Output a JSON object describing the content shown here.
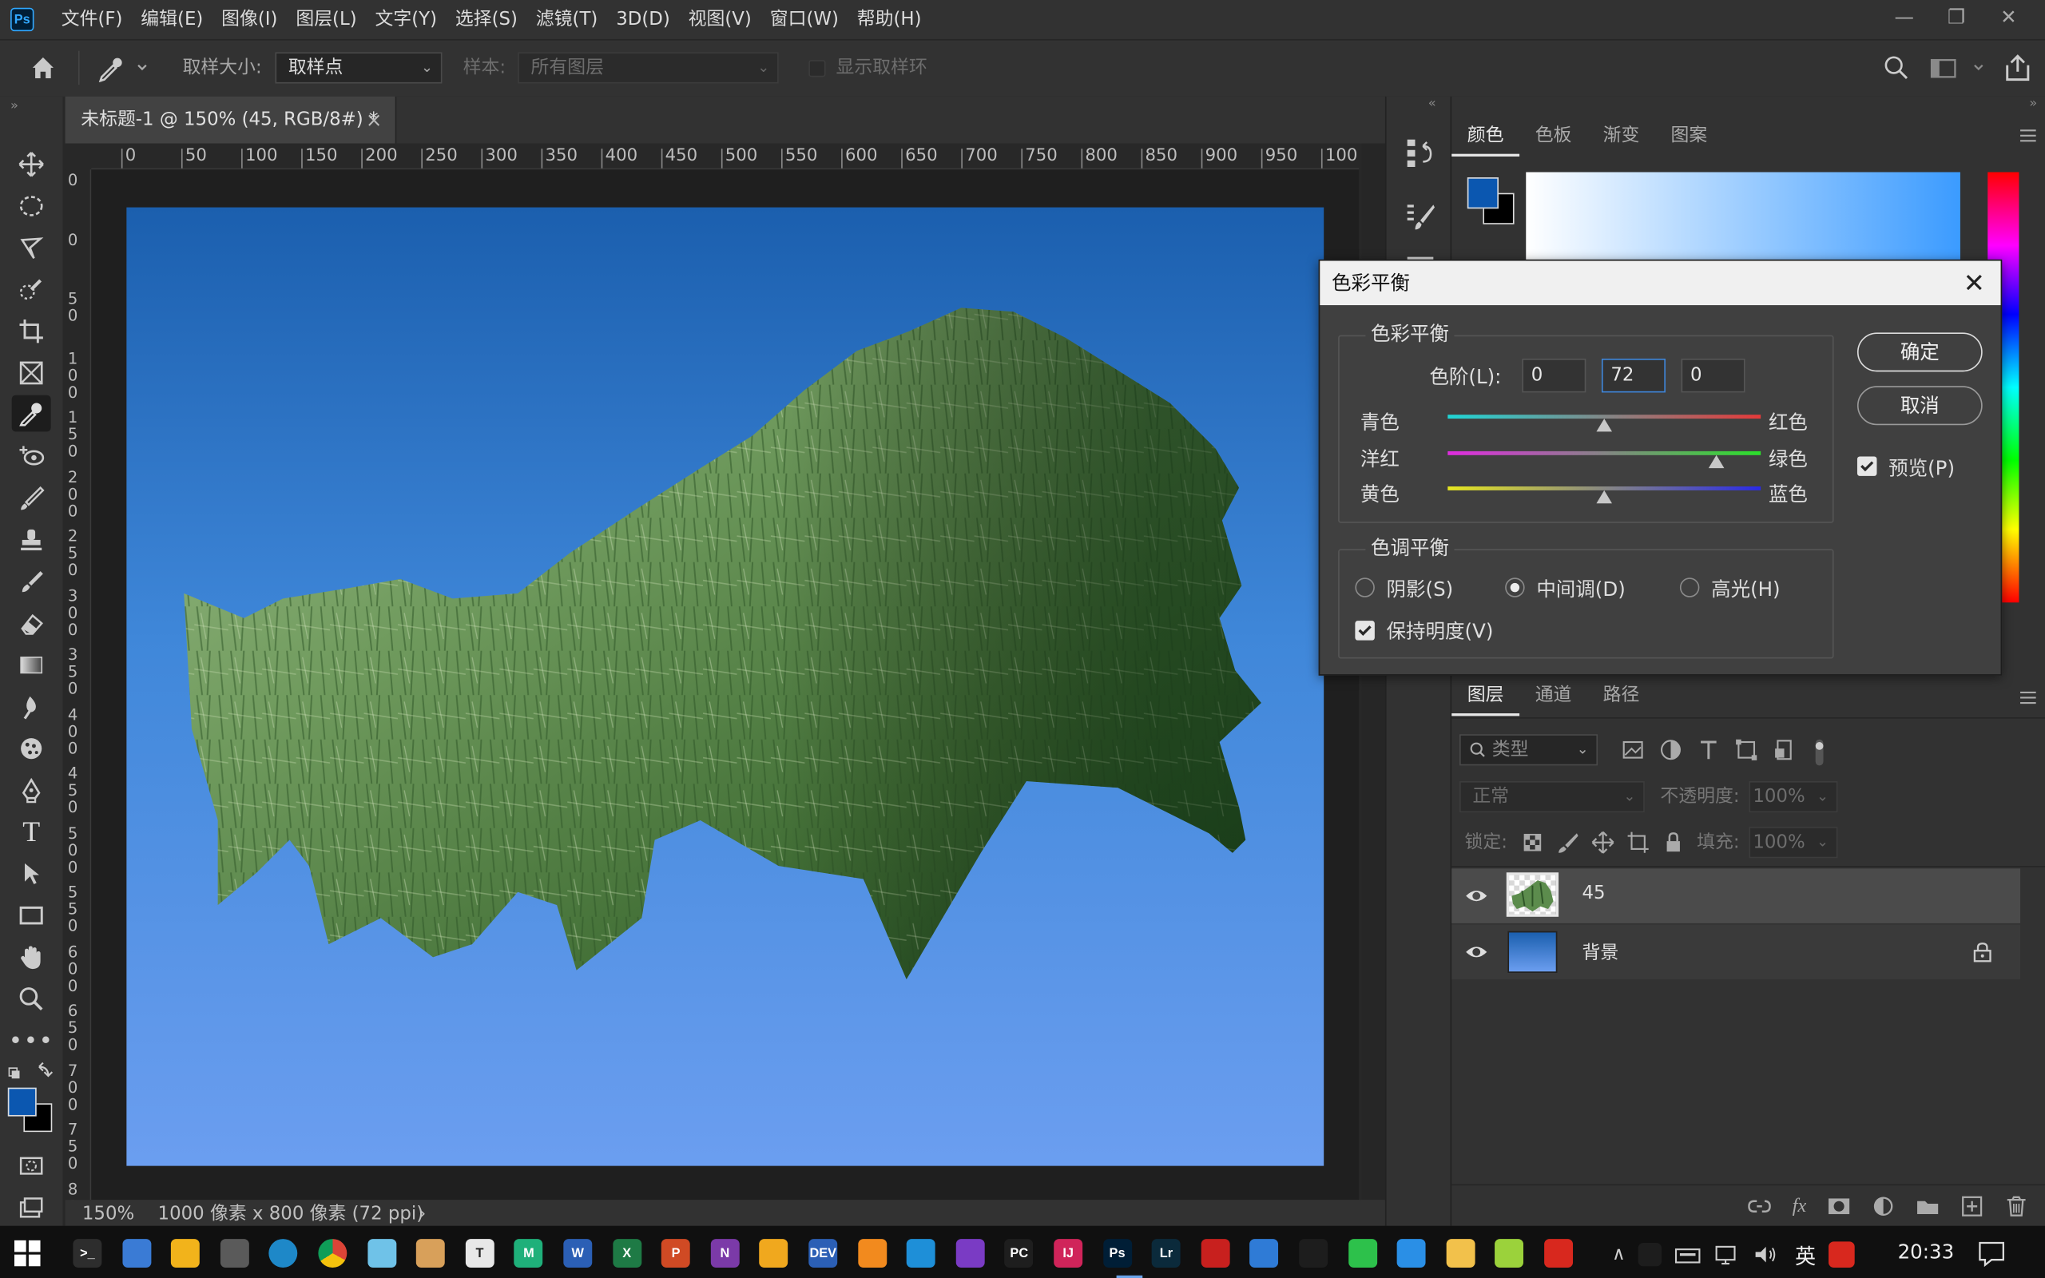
{
  "menubar": {
    "logo": "Ps",
    "items": [
      "文件(F)",
      "编辑(E)",
      "图像(I)",
      "图层(L)",
      "文字(Y)",
      "选择(S)",
      "滤镜(T)",
      "3D(D)",
      "视图(V)",
      "窗口(W)",
      "帮助(H)"
    ],
    "window_controls": [
      "—",
      "❐",
      "✕"
    ]
  },
  "options": {
    "sample_size_label": "取样大小:",
    "sample_size_value": "取样点",
    "sample_label": "样本:",
    "sample_value": "所有图层",
    "show_ring_label": "显示取样环"
  },
  "document": {
    "tab_title": "未标题-1 @ 150% (45, RGB/8#) *",
    "close": "×",
    "ruler_h": [
      "0",
      "50",
      "100",
      "150",
      "200",
      "250",
      "300",
      "350",
      "400",
      "450",
      "500",
      "550",
      "600",
      "650",
      "700",
      "750",
      "800",
      "850",
      "900",
      "950",
      "100"
    ],
    "ruler_v": [
      "0",
      "0",
      "5\n0",
      "1\n0\n0",
      "1\n5\n0",
      "2\n0\n0",
      "2\n5\n0",
      "3\n0\n0",
      "3\n5\n0",
      "4\n0\n0",
      "4\n5\n0",
      "5\n0\n0",
      "5\n5\n0",
      "6\n0\n0",
      "6\n5\n0",
      "7\n0\n0",
      "7\n5\n0",
      "8\n0\n0"
    ],
    "gradient_colors": [
      "#1b5fae",
      "#6b9ef0"
    ]
  },
  "status": {
    "zoom": "150%",
    "info": "1000 像素 x 800 像素 (72 ppi)",
    "arrow": "›"
  },
  "color_panel": {
    "tabs": [
      "颜色",
      "色板",
      "渐变",
      "图案"
    ],
    "foreground": "#0b57b0",
    "background": "#000000"
  },
  "layers_panel": {
    "tabs": [
      "图层",
      "通道",
      "路径"
    ],
    "filter_label": "类型",
    "blend_mode": "正常",
    "opacity_label": "不透明度:",
    "opacity_value": "100%",
    "lock_label": "锁定:",
    "fill_label": "填充:",
    "fill_value": "100%",
    "layers": [
      {
        "name": "45",
        "selected": true
      },
      {
        "name": "背景",
        "selected": false,
        "locked": true
      }
    ]
  },
  "dialog": {
    "title": "色彩平衡",
    "close": "✕",
    "balance_group": "色彩平衡",
    "levels_label": "色阶(L):",
    "levels": [
      "0",
      "72",
      "0"
    ],
    "sliders": [
      {
        "left": "青色",
        "right": "红色",
        "value": 0,
        "colors": [
          "#1fd6d6",
          "#e53a3a"
        ]
      },
      {
        "left": "洋红",
        "right": "绿色",
        "value": 72,
        "colors": [
          "#e02be0",
          "#2be02b"
        ]
      },
      {
        "left": "黄色",
        "right": "蓝色",
        "value": 0,
        "colors": [
          "#e6e620",
          "#2a2ae6"
        ]
      }
    ],
    "tone_group": "色调平衡",
    "tones": [
      "阴影(S)",
      "中间调(D)",
      "高光(H)"
    ],
    "tone_selected": 1,
    "preserve_label": "保持明度(V)",
    "ok": "确定",
    "cancel": "取消",
    "preview_label": "预览(P)"
  },
  "taskbar": {
    "time": "20:33",
    "ime": "英",
    "apps": [
      {
        "name": "terminal",
        "label": ">_",
        "color": "#2d2d2d"
      },
      {
        "name": "pc",
        "label": "",
        "color": "#3a7bd5"
      },
      {
        "name": "explorer",
        "label": "",
        "color": "#f2b31b"
      },
      {
        "name": "calculator",
        "label": "",
        "color": "#5a5a5a"
      },
      {
        "name": "edge",
        "label": "",
        "color": "#1e88c8"
      },
      {
        "name": "chrome",
        "label": "",
        "color": "#e0e0e0"
      },
      {
        "name": "notes",
        "label": "",
        "color": "#6fc2e8"
      },
      {
        "name": "paint",
        "label": "",
        "color": "#d8a05a"
      },
      {
        "name": "typora",
        "label": "T",
        "color": "#e8e8e8"
      },
      {
        "name": "mindmaster",
        "label": "M",
        "color": "#1fb07a"
      },
      {
        "name": "word",
        "label": "W",
        "color": "#2b5fb5"
      },
      {
        "name": "excel",
        "label": "X",
        "color": "#1e7a45"
      },
      {
        "name": "powerpoint",
        "label": "P",
        "color": "#d04a24"
      },
      {
        "name": "onenote",
        "label": "N",
        "color": "#7b3aa8"
      },
      {
        "name": "evernote",
        "label": "",
        "color": "#f0a81e"
      },
      {
        "name": "devcpp",
        "label": "DEV",
        "color": "#2b5fb5"
      },
      {
        "name": "sublime",
        "label": "",
        "color": "#f28a1e"
      },
      {
        "name": "vscode",
        "label": "",
        "color": "#1e8fd8"
      },
      {
        "name": "visualstudio",
        "label": "",
        "color": "#7a3bc4"
      },
      {
        "name": "pycharm",
        "label": "PC",
        "color": "#1e1e1e"
      },
      {
        "name": "intellij",
        "label": "IJ",
        "color": "#d0245a"
      },
      {
        "name": "photoshop",
        "label": "Ps",
        "color": "#001e36"
      },
      {
        "name": "lightroom",
        "label": "Lr",
        "color": "#0b2a3b"
      },
      {
        "name": "acrobat",
        "label": "",
        "color": "#c8201e"
      },
      {
        "name": "app-blue",
        "label": "",
        "color": "#2f7bd6"
      },
      {
        "name": "qq",
        "label": "",
        "color": "#1d1d1d"
      },
      {
        "name": "wechat",
        "label": "",
        "color": "#2dc14b"
      },
      {
        "name": "app-feather",
        "label": "",
        "color": "#2a8fe6"
      },
      {
        "name": "app-shop",
        "label": "",
        "color": "#f2c14b"
      },
      {
        "name": "app-green",
        "label": "",
        "color": "#9bd23b"
      },
      {
        "name": "netease-music",
        "label": "",
        "color": "#d8281e"
      }
    ]
  }
}
